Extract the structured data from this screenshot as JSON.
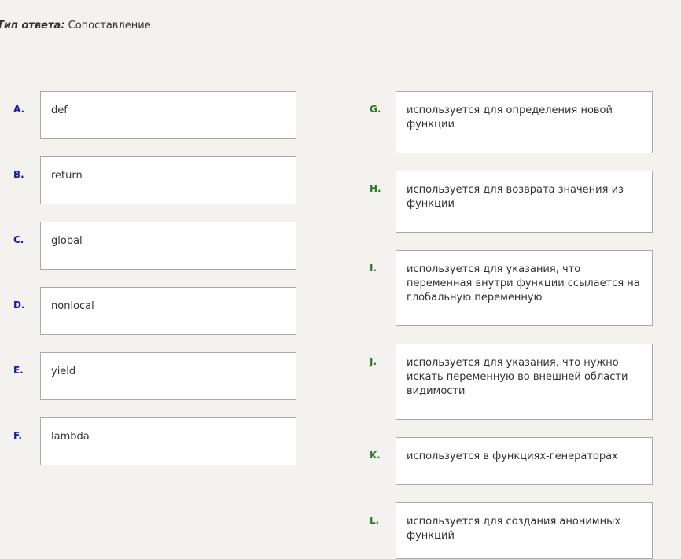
{
  "header": {
    "label": "Тип ответа:",
    "value": "Сопоставление"
  },
  "left_items": [
    {
      "letter": "A.",
      "text": "def"
    },
    {
      "letter": "B.",
      "text": "return"
    },
    {
      "letter": "C.",
      "text": "global"
    },
    {
      "letter": "D.",
      "text": "nonlocal"
    },
    {
      "letter": "E.",
      "text": "yield"
    },
    {
      "letter": "F.",
      "text": "lambda"
    }
  ],
  "right_items": [
    {
      "letter": "G.",
      "text": "используется для определения новой функции"
    },
    {
      "letter": "H.",
      "text": "используется для возврата значения из функции"
    },
    {
      "letter": "I.",
      "text": "используется для указания, что переменная внутри функции ссылается на глобальную переменную"
    },
    {
      "letter": "J.",
      "text": "используется для указания, что нужно искать переменную во внешней области видимости"
    },
    {
      "letter": "K.",
      "text": "используется в функциях-генераторах"
    },
    {
      "letter": "L.",
      "text": "используется для создания анонимных функций"
    }
  ]
}
